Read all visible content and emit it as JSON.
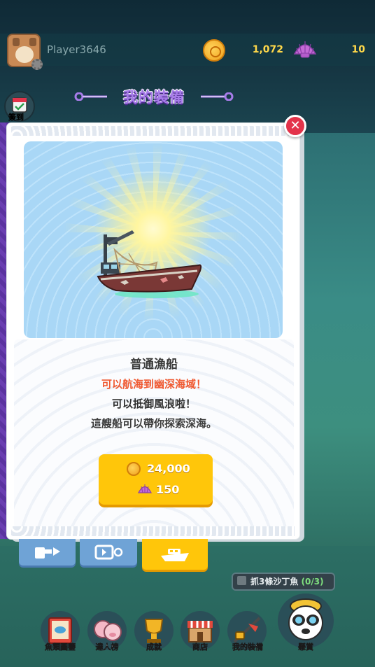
{
  "hud": {
    "player_name": "Player3646",
    "coins": "1,072",
    "shells": "10"
  },
  "sidebar": {
    "checkin_label": "簽到"
  },
  "panel": {
    "title": "我的裝備",
    "item_name": "普通漁船",
    "desc_highlight": "可以航海到幽深海域！",
    "desc_line2": "可以抵御風浪啦！",
    "desc_line3": "這艘船可以帶你探索深海。",
    "price_coins": "24,000",
    "price_shells": "150"
  },
  "tabs": [
    {
      "icon": "rod-icon",
      "selected": false
    },
    {
      "icon": "bait-icon",
      "selected": false
    },
    {
      "icon": "boat-icon",
      "selected": true
    }
  ],
  "quest": {
    "text": "抓3條沙丁魚",
    "progress": "(0/3)"
  },
  "nav": {
    "items": [
      {
        "label": "魚類圖鑒",
        "icon": "fish-book-icon"
      },
      {
        "label": "達人榜",
        "icon": "ranking-icon"
      },
      {
        "label": "成就",
        "icon": "trophy-icon"
      },
      {
        "label": "商店",
        "icon": "shop-icon"
      },
      {
        "label": "我的裝備",
        "icon": "equipment-icon"
      },
      {
        "label": "懸賞",
        "icon": "bounty-icon"
      }
    ]
  },
  "colors": {
    "accent_yellow": "#ffc60a",
    "highlight_red": "#f05a32",
    "close_red": "#e3334a",
    "title_purple": "#a77ce9"
  }
}
